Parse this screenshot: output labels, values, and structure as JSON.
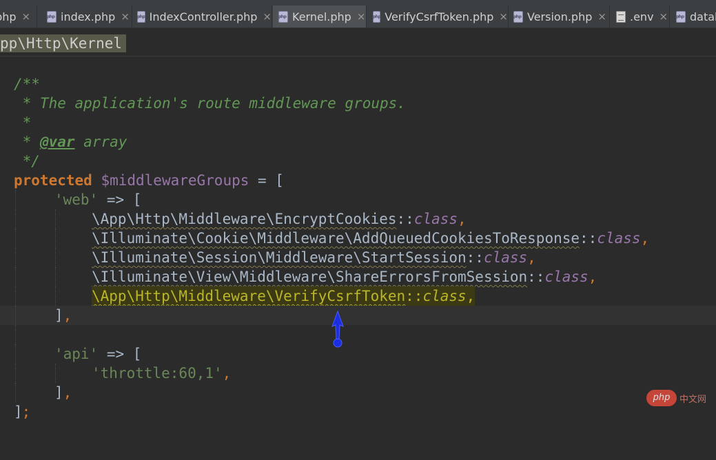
{
  "tabs": [
    {
      "label": ".php",
      "icon": "php-file-icon",
      "active": false
    },
    {
      "label": "index.php",
      "icon": "php-file-icon",
      "active": false
    },
    {
      "label": "IndexController.php",
      "icon": "php-file-icon",
      "active": false
    },
    {
      "label": "Kernel.php",
      "icon": "php-file-icon",
      "active": true
    },
    {
      "label": "VerifyCsrfToken.php",
      "icon": "php-file-icon",
      "active": false
    },
    {
      "label": "Version.php",
      "icon": "php-file-icon",
      "active": false
    },
    {
      "label": ".env",
      "icon": "text-file-icon",
      "active": false
    },
    {
      "label": "datab",
      "icon": "php-file-icon",
      "active": false
    }
  ],
  "close_glyph": "×",
  "breadcrumb": "pp\\Http\\Kernel",
  "code": {
    "doc_open": "/**",
    "doc_desc": " * The application's route middleware groups.",
    "doc_blank": " *",
    "doc_star": " * ",
    "doc_tag": "@var",
    "doc_type": " array",
    "doc_close": " */",
    "kw_protected": "protected",
    "var_name": " $middlewareGroups",
    "assign_open": " = [",
    "web_key": "'web'",
    "api_key": "'api'",
    "arrow_open": " => [",
    "middleware": [
      "\\App\\Http\\Middleware\\EncryptCookies",
      "\\Illuminate\\Cookie\\Middleware\\AddQueuedCookiesToResponse",
      "\\Illuminate\\Session\\Middleware\\StartSession",
      "\\Illuminate\\View\\Middleware\\ShareErrorsFromSession",
      "\\App\\Http\\Middleware\\VerifyCsrfToken"
    ],
    "scope_op": "::",
    "class_kw": "class",
    "comma": ",",
    "close_bracket": "]",
    "close_bracket_comma": "],",
    "throttle": "'throttle:60,1'",
    "final_close": "];"
  },
  "watermark": {
    "logo": "php",
    "text": "中文网"
  },
  "colors": {
    "keyword": "#cc7832",
    "string": "#6a8759",
    "doc_comment": "#629755",
    "variable": "#9876aa",
    "highlight": "#bbb529",
    "arrow": "#1b2fe0"
  }
}
